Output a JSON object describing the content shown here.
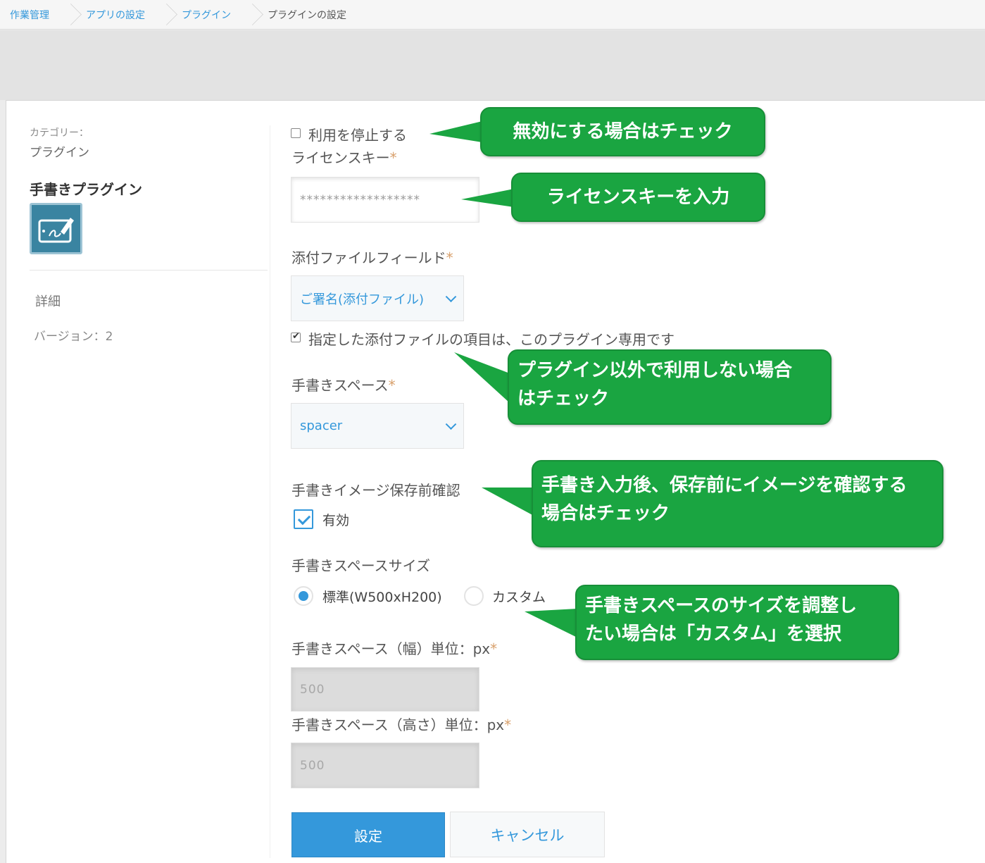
{
  "breadcrumb": [
    "作業管理",
    "アプリの設定",
    "プラグイン",
    "プラグインの設定"
  ],
  "sidebar": {
    "category_label": "カテゴリー：",
    "category_value": "プラグイン",
    "plugin_name": "手書きプラグイン",
    "detail_link": "詳細",
    "version": "バージョン：2"
  },
  "form": {
    "disable_label": "利用を停止する",
    "license_label": "ライセンスキー",
    "license_value": "******************",
    "attachment_label": "添付ファイルフィールド",
    "attachment_selected": "ご署名(添付ファイル)",
    "exclusive_label": "指定した添付ファイルの項目は、このプラグイン専用です",
    "space_label": "手書きスペース",
    "space_selected": "spacer",
    "confirm_label": "手書きイメージ保存前確認",
    "confirm_option": "有効",
    "size_label": "手書きスペースサイズ",
    "size_standard": "標準(W500xH200)",
    "size_custom": "カスタム",
    "width_label": "手書きスペース（幅）単位：px",
    "width_value": "500",
    "height_label": "手書きスペース（高さ）単位：px",
    "height_value": "500",
    "required_mark": "*",
    "save_button": "設定",
    "cancel_button": "キャンセル"
  },
  "callouts": {
    "disable": "無効にする場合はチェック",
    "license": "ライセンスキーを入力",
    "exclusive_line1": "プラグイン以外で利用しない場合",
    "exclusive_line2": "はチェック",
    "confirm_line1": "手書き入力後、保存前にイメージを確認する",
    "confirm_line2": "場合はチェック",
    "size_line1": "手書きスペースのサイズを調整し",
    "size_line2": "たい場合は「カスタム」を選択"
  },
  "colors": {
    "accent": "#3498db",
    "callout_green": "#1aa541",
    "required": "#d8a06c",
    "icon_bg": "#3a84a1"
  }
}
